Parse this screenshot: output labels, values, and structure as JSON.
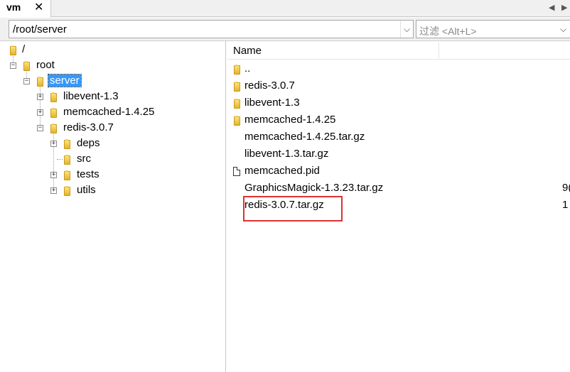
{
  "tabbar": {
    "active_tab": "vm",
    "close_glyph": "✕",
    "scroll_left": "◀",
    "scroll_right": "▶"
  },
  "address": {
    "path": "/root/server",
    "dropdown_glyph": "⌵"
  },
  "filter": {
    "placeholder": "过滤 <Alt+L>",
    "dropdown_glyph": "⌵"
  },
  "tree": {
    "root": "/",
    "root_child": "root",
    "selected": "server",
    "children": [
      "libevent-1.3",
      "memcached-1.4.25",
      "redis-3.0.7"
    ],
    "redis_children": [
      "deps",
      "src",
      "tests",
      "utils"
    ]
  },
  "list": {
    "column_name": "Name",
    "rows": [
      {
        "name": "..",
        "type": "folder"
      },
      {
        "name": "redis-3.0.7",
        "type": "folder"
      },
      {
        "name": "libevent-1.3",
        "type": "folder"
      },
      {
        "name": "memcached-1.4.25",
        "type": "folder"
      },
      {
        "name": "memcached-1.4.25.tar.gz",
        "type": "archive"
      },
      {
        "name": "libevent-1.3.tar.gz",
        "type": "archive"
      },
      {
        "name": "memcached.pid",
        "type": "file"
      },
      {
        "name": "GraphicsMagick-1.3.23.tar.gz",
        "type": "archive"
      },
      {
        "name": "redis-3.0.7.tar.gz",
        "type": "archive"
      }
    ],
    "partial_sizes": [
      "9(",
      "1"
    ],
    "highlight_color": "#e03030"
  }
}
